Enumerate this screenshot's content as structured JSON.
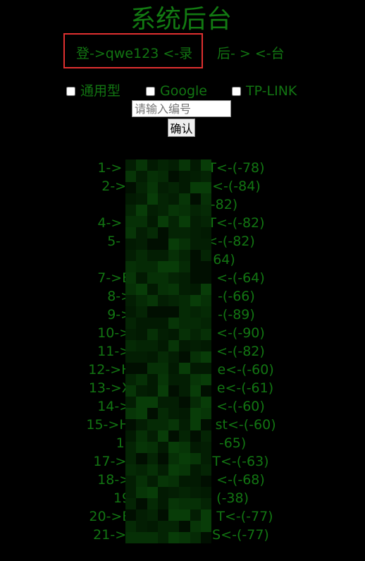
{
  "page": {
    "title": "系统后台",
    "highlight_color": "#e03030",
    "text_color": "#127512"
  },
  "login": {
    "text": "登->qwe123 <-录"
  },
  "backend": {
    "text": "后- > <-台"
  },
  "options": [
    {
      "label": "通用型",
      "checked": false
    },
    {
      "label": "Google",
      "checked": false
    },
    {
      "label": "TP-LINK",
      "checked": false
    }
  ],
  "code_input": {
    "placeholder": "请输入编号",
    "value": ""
  },
  "confirm_label": "确认",
  "results": [
    {
      "left": "1->",
      "right": "T<-(-78)"
    },
    {
      "left": "2->",
      "right": "<-(-84)"
    },
    {
      "left": "",
      "right": "-82)"
    },
    {
      "left": "4->",
      "right": "T<-(-82)"
    },
    {
      "left": "5-",
      "right": "<-(-82)"
    },
    {
      "left": "",
      "right": "64)"
    },
    {
      "left": "7->E",
      "right": "<-(-64)"
    },
    {
      "left": "8->",
      "right": "-(-66)"
    },
    {
      "left": "9->",
      "right": "-(-89)"
    },
    {
      "left": "10->",
      "right": "<-(-90)"
    },
    {
      "left": "11->",
      "right": "<-(-82)"
    },
    {
      "left": "12->H",
      "right": "e<-(-60)"
    },
    {
      "left": "13->X",
      "right": "e<-(-61)"
    },
    {
      "left": "14->",
      "right": "<-(-60)"
    },
    {
      "left": "15->H",
      "right": "st<-(-60)"
    },
    {
      "left": "16",
      "right": "-65)"
    },
    {
      "left": "17->",
      "right": "T<-(-63)"
    },
    {
      "left": "18->",
      "right": "<-(-68)"
    },
    {
      "left": "19",
      "right": "(-38)"
    },
    {
      "left": "20->E",
      "right": "T<-(-77)"
    },
    {
      "left": "21->",
      "right": "S<-(-77)"
    }
  ]
}
